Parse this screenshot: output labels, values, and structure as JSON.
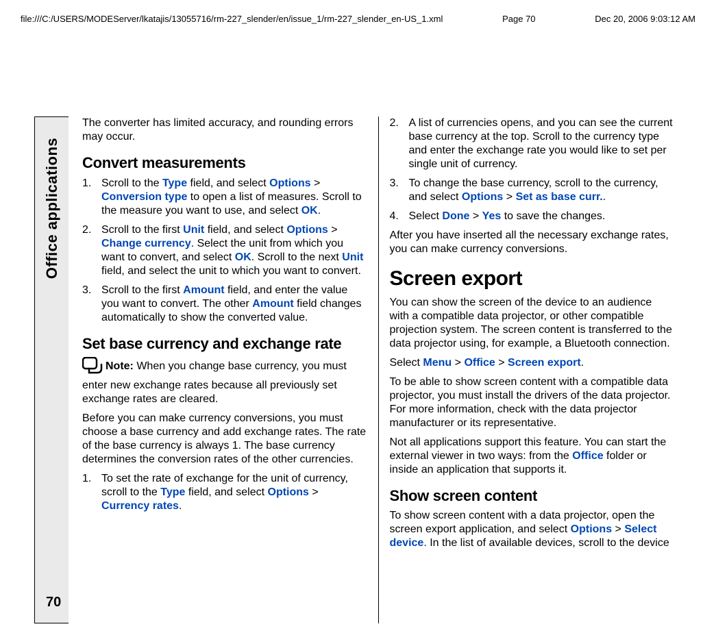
{
  "header": {
    "path": "file:///C:/USERS/MODEServer/lkatajis/13055716/rm-227_slender/en/issue_1/rm-227_slender_en-US_1.xml",
    "page": "Page 70",
    "date": "Dec 20, 2006 9:03:12 AM"
  },
  "sideTab": {
    "label": "Office applications",
    "pageNumber": "70"
  },
  "ui": {
    "Type": "Type",
    "Options": "Options",
    "ConversionType": "Conversion type",
    "OK": "OK",
    "Unit": "Unit",
    "ChangeCurrency": "Change currency",
    "Amount": "Amount",
    "CurrencyRates": "Currency rates",
    "SetAsBaseCurr": "Set as base curr.",
    "Done": "Done",
    "Yes": "Yes",
    "Menu": "Menu",
    "Office": "Office",
    "ScreenExport": "Screen export",
    "SelectDevice": "Select device"
  },
  "note": {
    "label": "Note:  "
  },
  "col1": {
    "intro": "The converter has limited accuracy, and rounding errors may occur.",
    "h_convert": "Convert measurements",
    "s1a": "Scroll to the ",
    "s1b": " field, and select ",
    "s1c": " to open a list of measures. Scroll to the measure you want to use, and select ",
    "s1d": ".",
    "s2a": "Scroll to the first ",
    "s2b": " field, and select ",
    "s2c": ". Select the unit from which you want to convert, and select ",
    "s2d": ". Scroll to the next ",
    "s2e": " field, and select the unit to which you want to convert.",
    "s3a": "Scroll to the first ",
    "s3b": " field, and enter the value you want to convert. The other ",
    "s3c": " field changes automatically to show the converted value.",
    "h_rate": "Set base currency and exchange rate",
    "noteText": "When you change base currency, you must enter new exchange rates because all previously set exchange rates are cleared.",
    "ratePre": "Before you can make currency conversions, you must choose a base currency and add exchange rates. The rate of the base currency is always 1. The base currency determines the conversion rates of the other currencies.",
    "r1a": "To set the rate of exchange for the unit of currency, scroll to the ",
    "r1b": " field, and select ",
    "r1c": "."
  },
  "col2": {
    "r2": "A list of currencies opens, and you can see the current base currency at the top. Scroll to the currency type and enter the exchange rate you would like to set per single unit of currency.",
    "r3a": "To change the base currency, scroll to the currency, and select ",
    "r3b": ".",
    "r4a": "Select ",
    "r4b": " to save the changes.",
    "afterRates": "After you have inserted all the necessary exchange rates, you can make currency conversions.",
    "h_screen": "Screen export",
    "screenIntro": "You can show the screen of the device to an audience with a compatible data projector, or other compatible projection system. The screen content is transferred to the data projector using, for example, a Bluetooth connection.",
    "selA": "Select ",
    "selDot": ".",
    "drivers": "To be able to show screen content with a compatible data projector, you must install the drivers of the data projector. For more information, check with the data projector manufacturer or its representative.",
    "notAllA": "Not all applications support this feature. You can start the external viewer in two ways: from the ",
    "notAllB": " folder or inside an application that supports it.",
    "h_show": "Show screen content",
    "showA": "To show screen content with a data projector, open the screen export application, and select ",
    "showB": ". In the list of available devices, scroll to the device"
  }
}
